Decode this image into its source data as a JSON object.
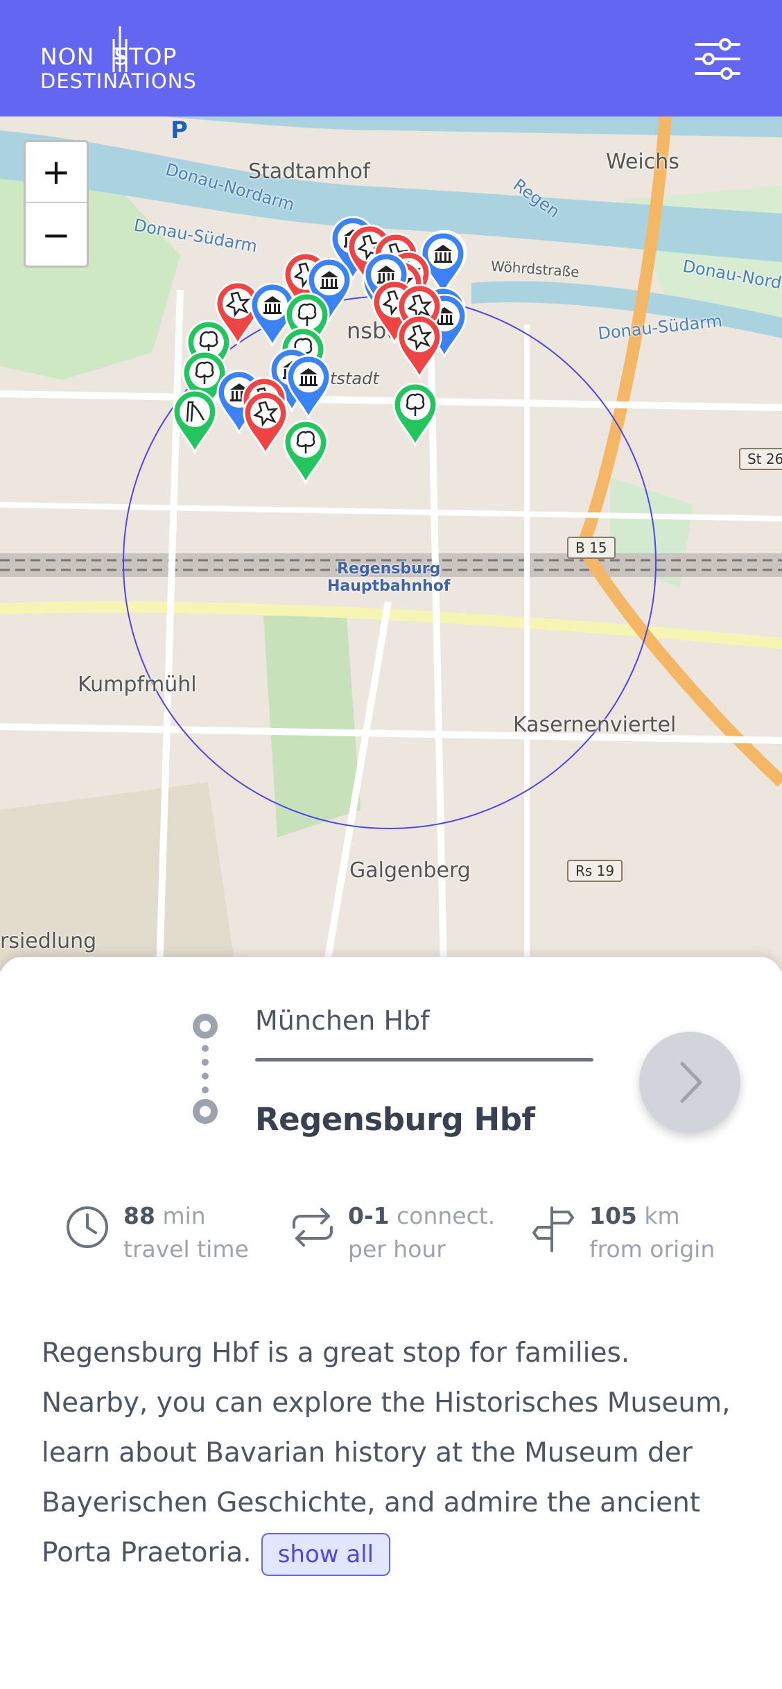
{
  "header": {
    "logo_line1_left": "NON",
    "logo_line1_right": "STOP",
    "logo_line2": "DESTINATIONS",
    "filter_icon": "sliders-icon"
  },
  "map": {
    "zoom_in_label": "+",
    "zoom_out_label": "−",
    "labels": {
      "stadtamhof": "Stadtamhof",
      "weichs": "Weichs",
      "regen": "Regen",
      "donau_nordarm": "Donau-Nordarm",
      "donau_suedarm": "Donau-Südarm",
      "donau_suedarm_right": "Donau-Südarm",
      "donau_nord_right": "Donau-Nord",
      "woehrdstrasse": "Wöhrdstraße",
      "parking": "P",
      "ensbu": "nsbu",
      "altstadt": "tstadt",
      "station_line1": "Regensburg",
      "station_line2": "Hauptbahnhof",
      "kumpfmuehl": "Kumpfmühl",
      "kasernenviertel": "Kasernenviertel",
      "galgenberg": "Galgenberg",
      "siedlung": "rsiedlung"
    },
    "road_shields": {
      "b15": "B 15",
      "st26": "St 26",
      "rs19": "Rs 19"
    },
    "pin_colors": {
      "museum": "#3b82f6",
      "sight": "#ef4444",
      "nature": "#22c55e"
    }
  },
  "route": {
    "origin": "München Hbf",
    "destination": "Regensburg Hbf",
    "next_icon": "chevron-right-icon"
  },
  "stats": {
    "travel_value": "88",
    "travel_unit": "min",
    "travel_label": "travel time",
    "connections_value": "0-1",
    "connections_unit": "connect.",
    "connections_label": "per hour",
    "distance_value": "105",
    "distance_unit": "km",
    "distance_label": "from origin"
  },
  "description": {
    "text": "Regensburg Hbf is a great stop for families. Nearby, you can explore the Historisches Museum, learn about Bavarian history at the Museum der Bayerischen Geschichte, and admire the ancient Porta Praetoria.",
    "show_all": "show all"
  }
}
